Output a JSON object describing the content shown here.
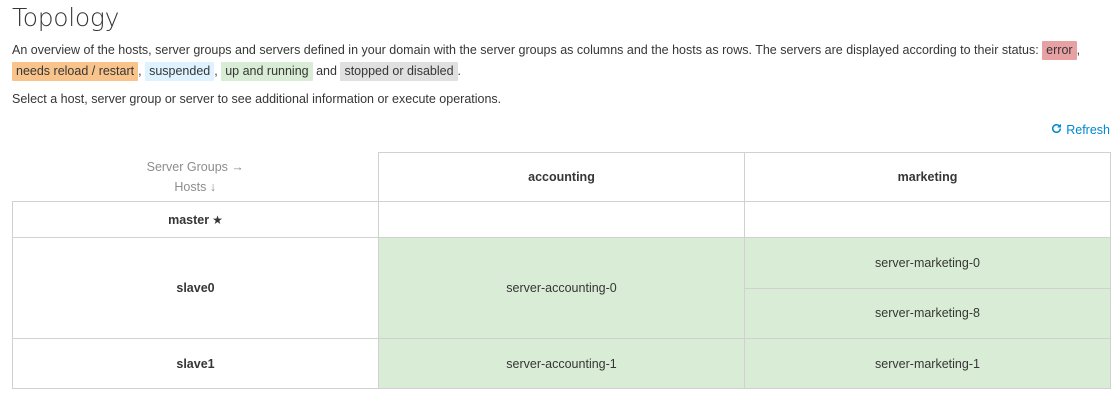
{
  "page": {
    "title": "Topology",
    "intro_text": "An overview of the hosts, server groups and servers defined in your domain with the server groups as columns and the hosts as rows. The servers are displayed according to their status:",
    "select_hint": "Select a host, server group or server to see additional information or execute operations.",
    "refresh_label": "Refresh"
  },
  "legend": {
    "error": "error",
    "needs_reload": "needs reload / restart",
    "suspended": "suspended",
    "running": "up and running",
    "and_word": "and",
    "stopped": "stopped or disabled",
    "colors": {
      "error": "#e8a1a2",
      "needs_reload": "#f9c48b",
      "suspended": "#def3ff",
      "running": "#d9ecd5",
      "stopped": "#e0e0e0"
    }
  },
  "table": {
    "corner_top": "Server Groups →",
    "corner_bottom": "Hosts ↓",
    "groups": [
      "accounting",
      "marketing"
    ],
    "hosts": {
      "master": "master",
      "slave0": "slave0",
      "slave1": "slave1"
    },
    "master_icon": "star-icon",
    "servers": {
      "slave0_accounting": "server-accounting-0",
      "slave0_marketing_0": "server-marketing-0",
      "slave0_marketing_8": "server-marketing-8",
      "slave1_accounting": "server-accounting-1",
      "slave1_marketing": "server-marketing-1"
    }
  },
  "colors": {
    "link": "#0088ce",
    "border": "#d1d1d1"
  }
}
